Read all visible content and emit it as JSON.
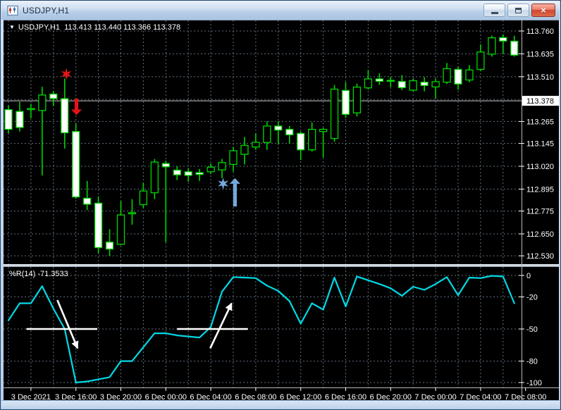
{
  "window": {
    "title": "USDJPY,H1",
    "controls": {
      "minimize": "minimize-icon",
      "restore": "restore-icon",
      "close_glyph": "×"
    }
  },
  "chart": {
    "readout": "USDJPY,H1  113.413 113.440 113.366 113.378",
    "dropdown_glyph": "▼",
    "ohlc": {
      "open": "113.413",
      "high": "113.440",
      "low": "113.366",
      "close": "113.378"
    },
    "current_price_label": "113.378",
    "price_axis_labels": [
      "113.760",
      "113.635",
      "113.510",
      "113.378",
      "113.265",
      "113.145",
      "113.020",
      "112.895",
      "112.775",
      "112.650",
      "112.530"
    ],
    "time_axis_labels": [
      "3 Dec 2021",
      "3 Dec 16:00",
      "3 Dec 20:00",
      "6 Dec 00:00",
      "6 Dec 04:00",
      "6 Dec 08:00",
      "6 Dec 12:00",
      "6 Dec 16:00",
      "6 Dec 20:00",
      "7 Dec 00:00",
      "7 Dec 04:00",
      "7 Dec 08:00"
    ]
  },
  "indicator": {
    "label": "%R(14) -71.3533",
    "axis_labels": [
      "0",
      "-20",
      "-50",
      "-80",
      "-100"
    ]
  },
  "colors": {
    "background": "#000000",
    "grid": "#5f7081",
    "candle_outline": "#00d400",
    "bull_fill": "#000000",
    "bear_fill": "#ffffff",
    "price_line": "#c9c9c9",
    "axis_text": "#ffffff",
    "wr_line": "#00d9e6",
    "sell": "#e51414",
    "buy": "#73a9dc",
    "annotation": "#ffffff",
    "axis_frame": "#b8b8b8"
  },
  "chart_data": [
    {
      "type": "candlestick",
      "title": "USDJPY,H1",
      "ylim": [
        112.53,
        113.76
      ],
      "price_ticks": [
        113.76,
        113.635,
        113.51,
        113.378,
        113.265,
        113.145,
        113.02,
        112.895,
        112.775,
        112.65,
        112.53
      ],
      "hidden_grid_level": 113.385,
      "current_price": 113.378,
      "time_labels": [
        {
          "label": "3 Dec 2021",
          "bar": 2
        },
        {
          "label": "3 Dec 16:00",
          "bar": 6
        },
        {
          "label": "3 Dec 20:00",
          "bar": 10
        },
        {
          "label": "6 Dec 00:00",
          "bar": 14
        },
        {
          "label": "6 Dec 04:00",
          "bar": 18
        },
        {
          "label": "6 Dec 08:00",
          "bar": 22
        },
        {
          "label": "6 Dec 12:00",
          "bar": 26
        },
        {
          "label": "6 Dec 16:00",
          "bar": 30
        },
        {
          "label": "6 Dec 20:00",
          "bar": 34
        },
        {
          "label": "7 Dec 00:00",
          "bar": 38
        },
        {
          "label": "7 Dec 04:00",
          "bar": 42
        },
        {
          "label": "7 Dec 08:00",
          "bar": 46
        }
      ],
      "candles": [
        {
          "t": "3 Dec 10:00",
          "o": 113.33,
          "h": 113.352,
          "l": 113.2,
          "c": 113.222
        },
        {
          "t": "3 Dec 11:00",
          "o": 113.32,
          "h": 113.372,
          "l": 113.21,
          "c": 113.232
        },
        {
          "t": "3 Dec 12:00",
          "o": 113.33,
          "h": 113.362,
          "l": 113.282,
          "c": 113.336
        },
        {
          "t": "3 Dec 13:00",
          "o": 113.325,
          "h": 113.455,
          "l": 112.97,
          "c": 113.41
        },
        {
          "t": "3 Dec 14:00",
          "o": 113.415,
          "h": 113.432,
          "l": 113.35,
          "c": 113.39
        },
        {
          "t": "3 Dec 15:00",
          "o": 113.39,
          "h": 113.5,
          "l": 113.117,
          "c": 113.203
        },
        {
          "t": "3 Dec 16:00",
          "o": 113.21,
          "h": 113.255,
          "l": 112.842,
          "c": 112.852
        },
        {
          "t": "3 Dec 17:00",
          "o": 112.845,
          "h": 112.94,
          "l": 112.78,
          "c": 112.812
        },
        {
          "t": "3 Dec 18:00",
          "o": 112.818,
          "h": 112.855,
          "l": 112.545,
          "c": 112.575
        },
        {
          "t": "3 Dec 19:00",
          "o": 112.605,
          "h": 112.676,
          "l": 112.53,
          "c": 112.567
        },
        {
          "t": "3 Dec 20:00",
          "o": 112.593,
          "h": 112.828,
          "l": 112.588,
          "c": 112.754
        },
        {
          "t": "3 Dec 21:00",
          "o": 112.76,
          "h": 112.84,
          "l": 112.7,
          "c": 112.766
        },
        {
          "t": "3 Dec 22:00",
          "o": 112.81,
          "h": 112.93,
          "l": 112.79,
          "c": 112.885
        },
        {
          "t": "3 Dec 23:00",
          "o": 112.875,
          "h": 113.06,
          "l": 112.84,
          "c": 113.043
        },
        {
          "t": "6 Dec 00:00",
          "o": 113.035,
          "h": 113.05,
          "l": 112.605,
          "c": 113.017
        },
        {
          "t": "6 Dec 01:00",
          "o": 112.999,
          "h": 113.02,
          "l": 112.945,
          "c": 112.973
        },
        {
          "t": "6 Dec 02:00",
          "o": 112.99,
          "h": 113.01,
          "l": 112.935,
          "c": 112.97
        },
        {
          "t": "6 Dec 03:00",
          "o": 112.985,
          "h": 113.005,
          "l": 112.94,
          "c": 112.975
        },
        {
          "t": "6 Dec 04:00",
          "o": 112.99,
          "h": 113.035,
          "l": 112.978,
          "c": 113.015
        },
        {
          "t": "6 Dec 05:00",
          "o": 113.0,
          "h": 113.06,
          "l": 112.955,
          "c": 113.04
        },
        {
          "t": "6 Dec 06:00",
          "o": 113.03,
          "h": 113.127,
          "l": 112.99,
          "c": 113.105
        },
        {
          "t": "6 Dec 07:00",
          "o": 113.085,
          "h": 113.18,
          "l": 113.03,
          "c": 113.134
        },
        {
          "t": "6 Dec 08:00",
          "o": 113.125,
          "h": 113.2,
          "l": 113.11,
          "c": 113.151
        },
        {
          "t": "6 Dec 09:00",
          "o": 113.15,
          "h": 113.266,
          "l": 113.11,
          "c": 113.24
        },
        {
          "t": "6 Dec 10:00",
          "o": 113.24,
          "h": 113.266,
          "l": 113.143,
          "c": 113.218
        },
        {
          "t": "6 Dec 11:00",
          "o": 113.222,
          "h": 113.24,
          "l": 113.143,
          "c": 113.192
        },
        {
          "t": "6 Dec 12:00",
          "o": 113.2,
          "h": 113.21,
          "l": 113.054,
          "c": 113.11
        },
        {
          "t": "6 Dec 13:00",
          "o": 113.11,
          "h": 113.26,
          "l": 113.1,
          "c": 113.222
        },
        {
          "t": "6 Dec 14:00",
          "o": 113.21,
          "h": 113.23,
          "l": 113.068,
          "c": 113.222
        },
        {
          "t": "6 Dec 15:00",
          "o": 113.172,
          "h": 113.465,
          "l": 113.154,
          "c": 113.442
        },
        {
          "t": "6 Dec 16:00",
          "o": 113.435,
          "h": 113.48,
          "l": 113.285,
          "c": 113.304
        },
        {
          "t": "6 Dec 17:00",
          "o": 113.312,
          "h": 113.472,
          "l": 113.293,
          "c": 113.453
        },
        {
          "t": "6 Dec 18:00",
          "o": 113.449,
          "h": 113.546,
          "l": 113.44,
          "c": 113.498
        },
        {
          "t": "6 Dec 19:00",
          "o": 113.498,
          "h": 113.528,
          "l": 113.465,
          "c": 113.485
        },
        {
          "t": "6 Dec 20:00",
          "o": 113.49,
          "h": 113.51,
          "l": 113.453,
          "c": 113.487
        },
        {
          "t": "6 Dec 21:00",
          "o": 113.484,
          "h": 113.518,
          "l": 113.436,
          "c": 113.45
        },
        {
          "t": "6 Dec 22:00",
          "o": 113.436,
          "h": 113.5,
          "l": 113.43,
          "c": 113.488
        },
        {
          "t": "6 Dec 23:00",
          "o": 113.48,
          "h": 113.507,
          "l": 113.43,
          "c": 113.462
        },
        {
          "t": "7 Dec 00:00",
          "o": 113.454,
          "h": 113.5,
          "l": 113.39,
          "c": 113.483
        },
        {
          "t": "7 Dec 01:00",
          "o": 113.48,
          "h": 113.585,
          "l": 113.47,
          "c": 113.554
        },
        {
          "t": "7 Dec 02:00",
          "o": 113.55,
          "h": 113.565,
          "l": 113.438,
          "c": 113.47
        },
        {
          "t": "7 Dec 03:00",
          "o": 113.492,
          "h": 113.573,
          "l": 113.48,
          "c": 113.547
        },
        {
          "t": "7 Dec 04:00",
          "o": 113.55,
          "h": 113.687,
          "l": 113.54,
          "c": 113.645
        },
        {
          "t": "7 Dec 05:00",
          "o": 113.633,
          "h": 113.735,
          "l": 113.62,
          "c": 113.723
        },
        {
          "t": "7 Dec 06:00",
          "o": 113.724,
          "h": 113.742,
          "l": 113.633,
          "c": 113.705
        },
        {
          "t": "7 Dec 07:00",
          "o": 113.704,
          "h": 113.734,
          "l": 113.62,
          "c": 113.628
        }
      ],
      "annotations": [
        {
          "shape": "star",
          "signal": "sell",
          "bar": 5.15,
          "price": 113.525,
          "color_key": "sell"
        },
        {
          "shape": "arrow-down",
          "signal": "sell-entry",
          "bar": 6.05,
          "price_from": 113.39,
          "price_to": 113.3,
          "color_key": "sell"
        },
        {
          "shape": "star",
          "signal": "buy",
          "bar": 19.1,
          "price": 112.925,
          "color_key": "buy"
        },
        {
          "shape": "arrow-up",
          "signal": "buy-entry",
          "bar": 20.15,
          "price_from": 112.8,
          "price_to": 112.955,
          "color_key": "buy"
        }
      ]
    },
    {
      "type": "line",
      "name": "Williams %R(14)",
      "label": "%R(14) -71.3533",
      "current_value": -71.3533,
      "ylim": [
        -100,
        0
      ],
      "ticks": [
        0,
        -20,
        -50,
        -80,
        -100
      ],
      "dashed_levels": [
        0,
        -20,
        -50,
        -80,
        -100
      ],
      "values": [
        -42,
        -26,
        -26,
        -10,
        -31,
        -50,
        -100,
        -99,
        -97,
        -95,
        -80,
        -80,
        -67,
        -54,
        -54,
        -56,
        -57,
        -58,
        -48,
        -15,
        -1.5,
        -2,
        -2.5,
        -9.5,
        -14.5,
        -24,
        -45,
        -26,
        -32,
        -2,
        -29,
        -1,
        -4.5,
        -8,
        -12,
        -19,
        -10.5,
        -13.5,
        -8,
        -1.5,
        -18.5,
        -2,
        -2.5,
        -0.3,
        -1,
        -26
      ],
      "annotations": [
        {
          "shape": "segment",
          "level": -50,
          "bar_from": 1.6,
          "bar_to": 7.9
        },
        {
          "shape": "arrow",
          "dir": "down",
          "bar_from": 4.35,
          "level_from": -23,
          "bar_to": 6.15,
          "level_to": -68
        },
        {
          "shape": "segment",
          "level": -50,
          "bar_from": 15.0,
          "bar_to": 21.3
        },
        {
          "shape": "arrow",
          "dir": "up",
          "bar_from": 17.95,
          "level_from": -68,
          "bar_to": 19.85,
          "level_to": -26
        }
      ]
    }
  ]
}
